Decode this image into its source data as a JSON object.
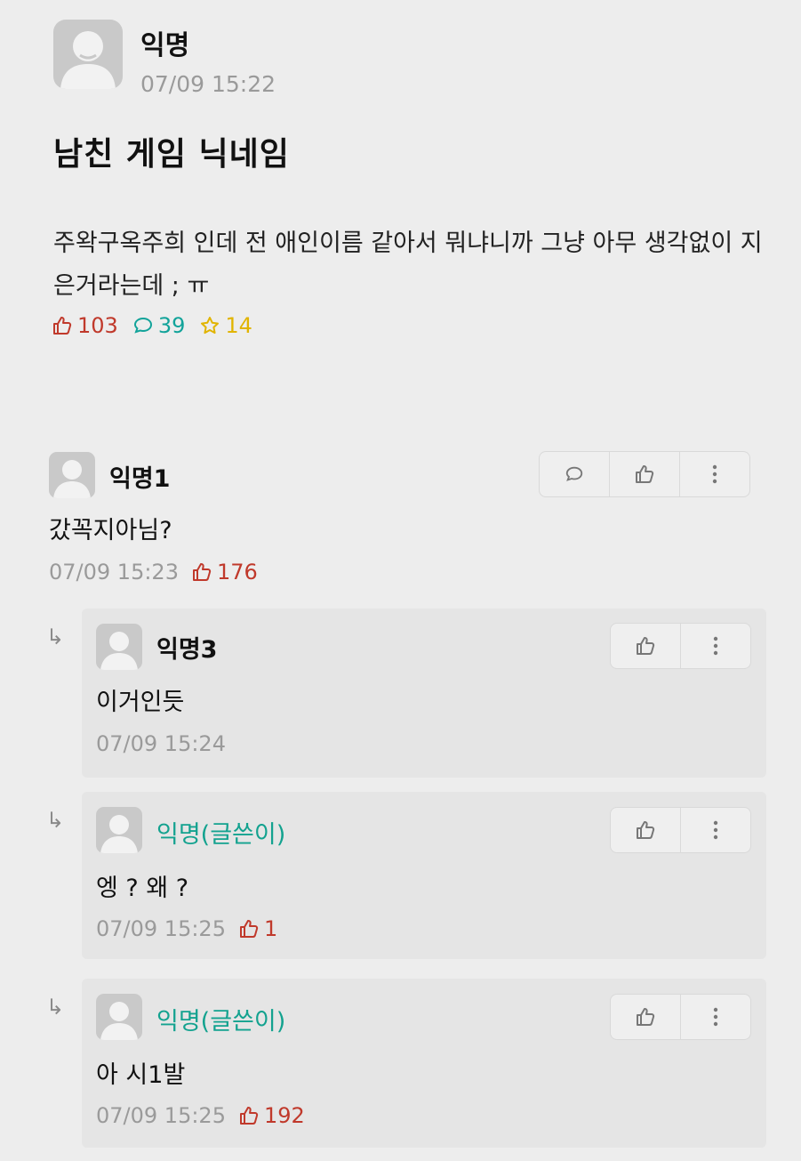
{
  "post": {
    "author": "익명",
    "time": "07/09 15:22",
    "title": "남친 게임 닉네임",
    "body": "주왁구옥주희 인데 전 애인이름 같아서 뭐냐니까 그냥 아무 생각없이 지은거라는데 ; ㅠ",
    "likes": "103",
    "comments": "39",
    "scraps": "14"
  },
  "comments": [
    {
      "author": "익명1",
      "text": "갔꼭지아님?",
      "time": "07/09 15:23",
      "likes": "176"
    },
    {
      "author": "익명3",
      "text": "이거인듯",
      "time": "07/09 15:24",
      "likes": ""
    },
    {
      "author": "익명(글쓴이)",
      "text": "엥 ? 왜 ?",
      "time": "07/09 15:25",
      "likes": "1"
    },
    {
      "author": "익명(글쓴이)",
      "text": "아 시1발",
      "time": "07/09 15:25",
      "likes": "192"
    }
  ],
  "colors": {
    "like": "#c0392b",
    "comment": "#12a39a",
    "scrap": "#e1b400",
    "op_author": "#13a28f"
  },
  "icons": [
    "avatar-icon",
    "thumbs-up-icon",
    "comment-bubble-icon",
    "star-icon",
    "more-vertical-icon",
    "reply-arrow-icon"
  ]
}
